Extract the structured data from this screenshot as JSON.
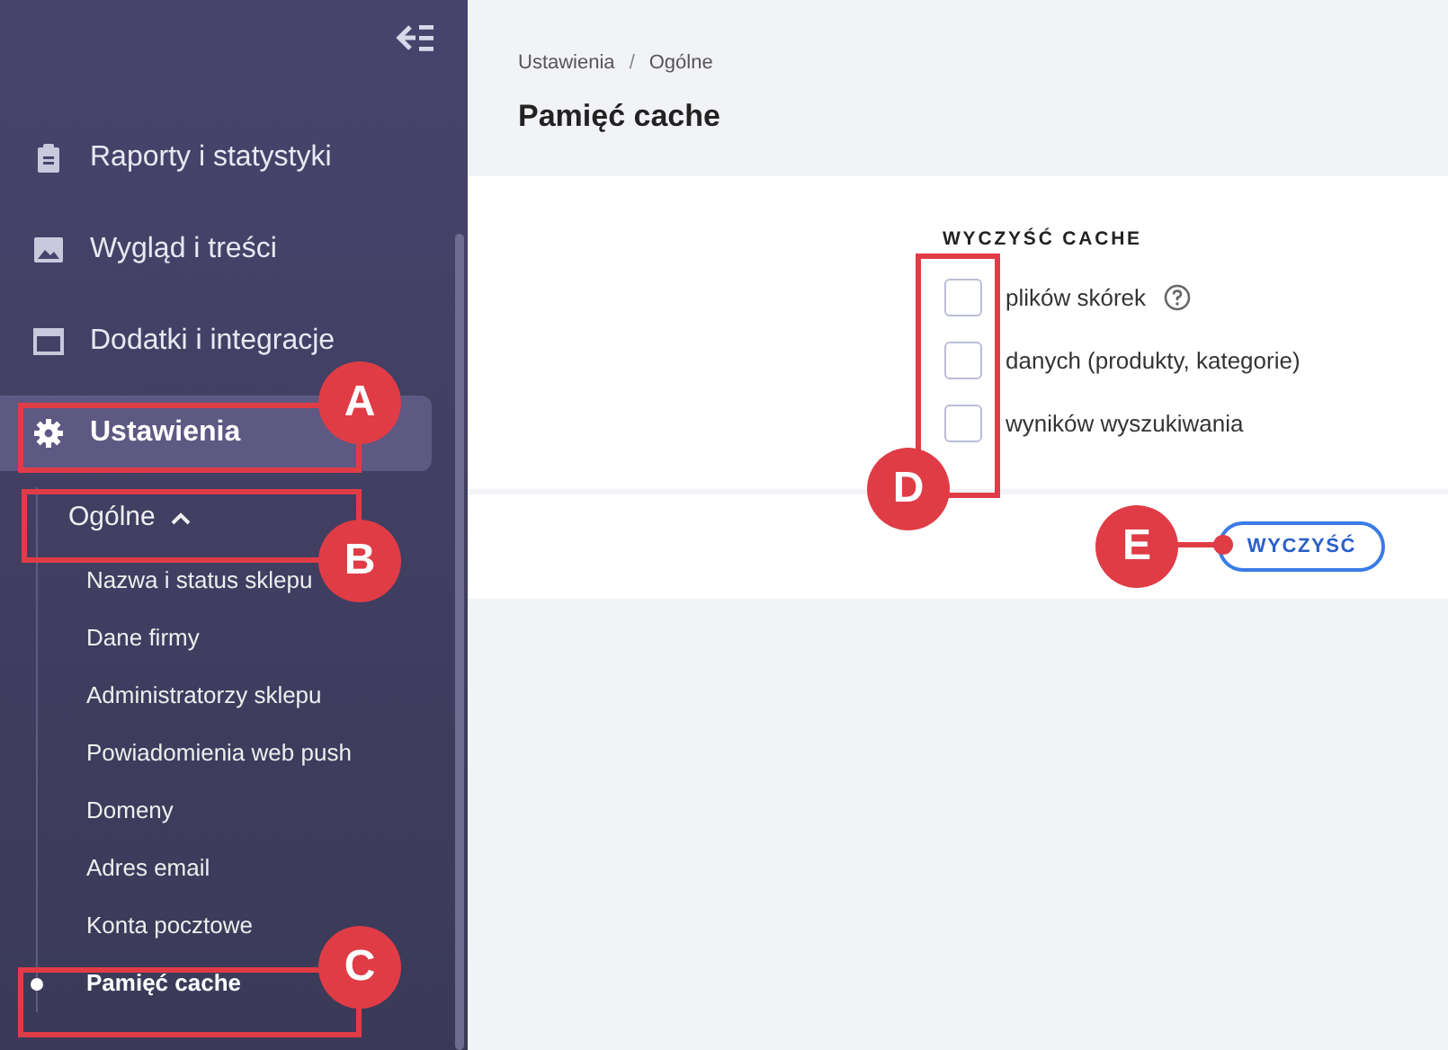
{
  "sidebar": {
    "items": [
      {
        "label": "Raporty i statystyki",
        "selected": false
      },
      {
        "label": "Wygląd i treści",
        "selected": false
      },
      {
        "label": "Dodatki i integracje",
        "selected": false
      },
      {
        "label": "Ustawienia",
        "selected": true
      }
    ],
    "group": {
      "label": "Ogólne",
      "expanded": true,
      "children": [
        {
          "label": "Nazwa i status sklepu",
          "selected": false
        },
        {
          "label": "Dane firmy",
          "selected": false
        },
        {
          "label": "Administratorzy sklepu",
          "selected": false
        },
        {
          "label": "Powiadomienia web push",
          "selected": false
        },
        {
          "label": "Domeny",
          "selected": false
        },
        {
          "label": "Adres email",
          "selected": false
        },
        {
          "label": "Konta pocztowe",
          "selected": false
        },
        {
          "label": "Pamięć cache",
          "selected": true
        }
      ]
    }
  },
  "breadcrumb": [
    "Ustawienia",
    "Ogólne"
  ],
  "breadcrumb_separator": "/",
  "page_title": "Pamięć cache",
  "form": {
    "heading": "WYCZYŚĆ CACHE",
    "options": [
      {
        "label": "plików skórek",
        "checked": false,
        "help": true
      },
      {
        "label": "danych (produkty, kategorie)",
        "checked": false,
        "help": false
      },
      {
        "label": "wyników wyszukiwania",
        "checked": false,
        "help": false
      }
    ],
    "button": "WYCZYŚĆ"
  },
  "callouts": [
    {
      "label": "A"
    },
    {
      "label": "B"
    },
    {
      "label": "C"
    },
    {
      "label": "D"
    },
    {
      "label": "E"
    }
  ]
}
